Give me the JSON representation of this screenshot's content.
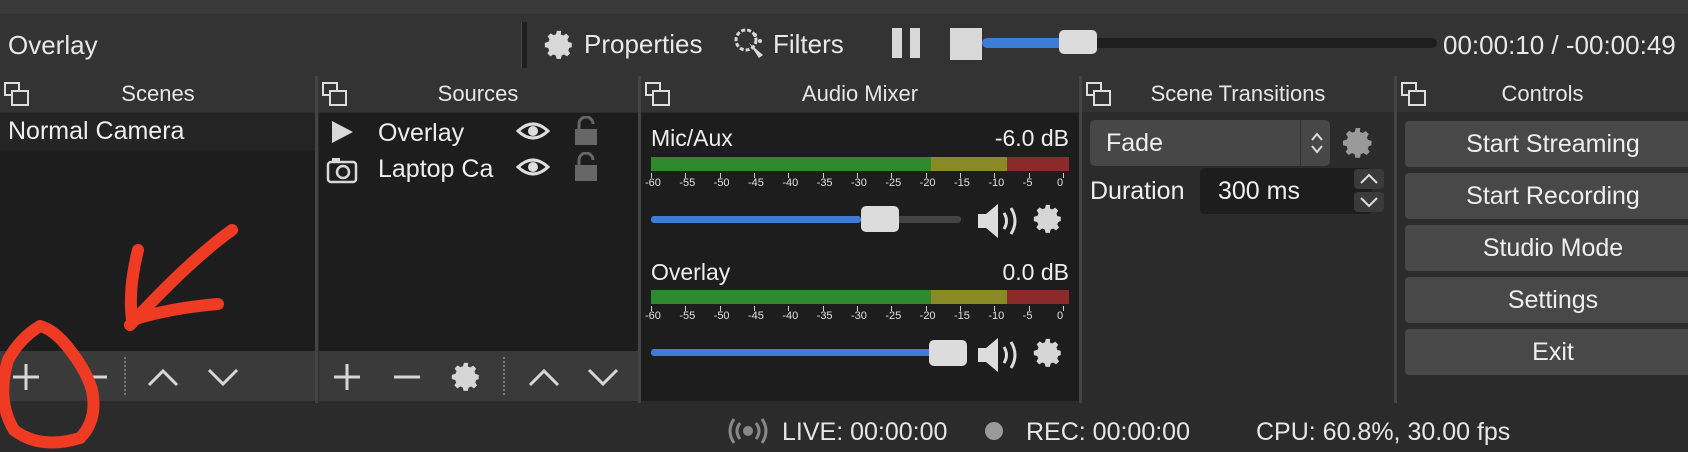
{
  "toolbar": {
    "scene_name": "Overlay",
    "properties_label": "Properties",
    "filters_label": "Filters",
    "time": "00:00:10 / -00:00:49",
    "seek_progress": 0.21
  },
  "scenes": {
    "title": "Scenes",
    "items": [
      "Normal Camera"
    ]
  },
  "sources": {
    "title": "Sources",
    "items": [
      {
        "label": "Overlay",
        "icon": "play-icon"
      },
      {
        "label": "Laptop Ca",
        "icon": "camera-icon"
      }
    ]
  },
  "audio_mixer": {
    "title": "Audio Mixer",
    "channels": [
      {
        "name": "Mic/Aux",
        "db": "-6.0 dB",
        "volume": 0.72
      },
      {
        "name": "Overlay",
        "db": "0.0 dB",
        "volume": 1.0
      }
    ],
    "scale": [
      "-60",
      "-55",
      "-50",
      "-45",
      "-40",
      "-35",
      "-30",
      "-25",
      "-20",
      "-15",
      "-10",
      "-5",
      "0"
    ]
  },
  "transitions": {
    "title": "Scene Transitions",
    "selected": "Fade",
    "duration_label": "Duration",
    "duration_value": "300 ms"
  },
  "controls": {
    "title": "Controls",
    "buttons": [
      "Start Streaming",
      "Start Recording",
      "Studio Mode",
      "Settings",
      "Exit"
    ]
  },
  "status": {
    "live": "LIVE: 00:00:00",
    "rec": "REC: 00:00:00",
    "cpu": "CPU: 60.8%, 30.00 fps"
  },
  "colors": {
    "accent": "#3d7dd8",
    "annotation": "#ef3b24",
    "meter_green": "#2f8a2f",
    "meter_yellow": "#8a8a26",
    "meter_red": "#8a2a2a"
  }
}
